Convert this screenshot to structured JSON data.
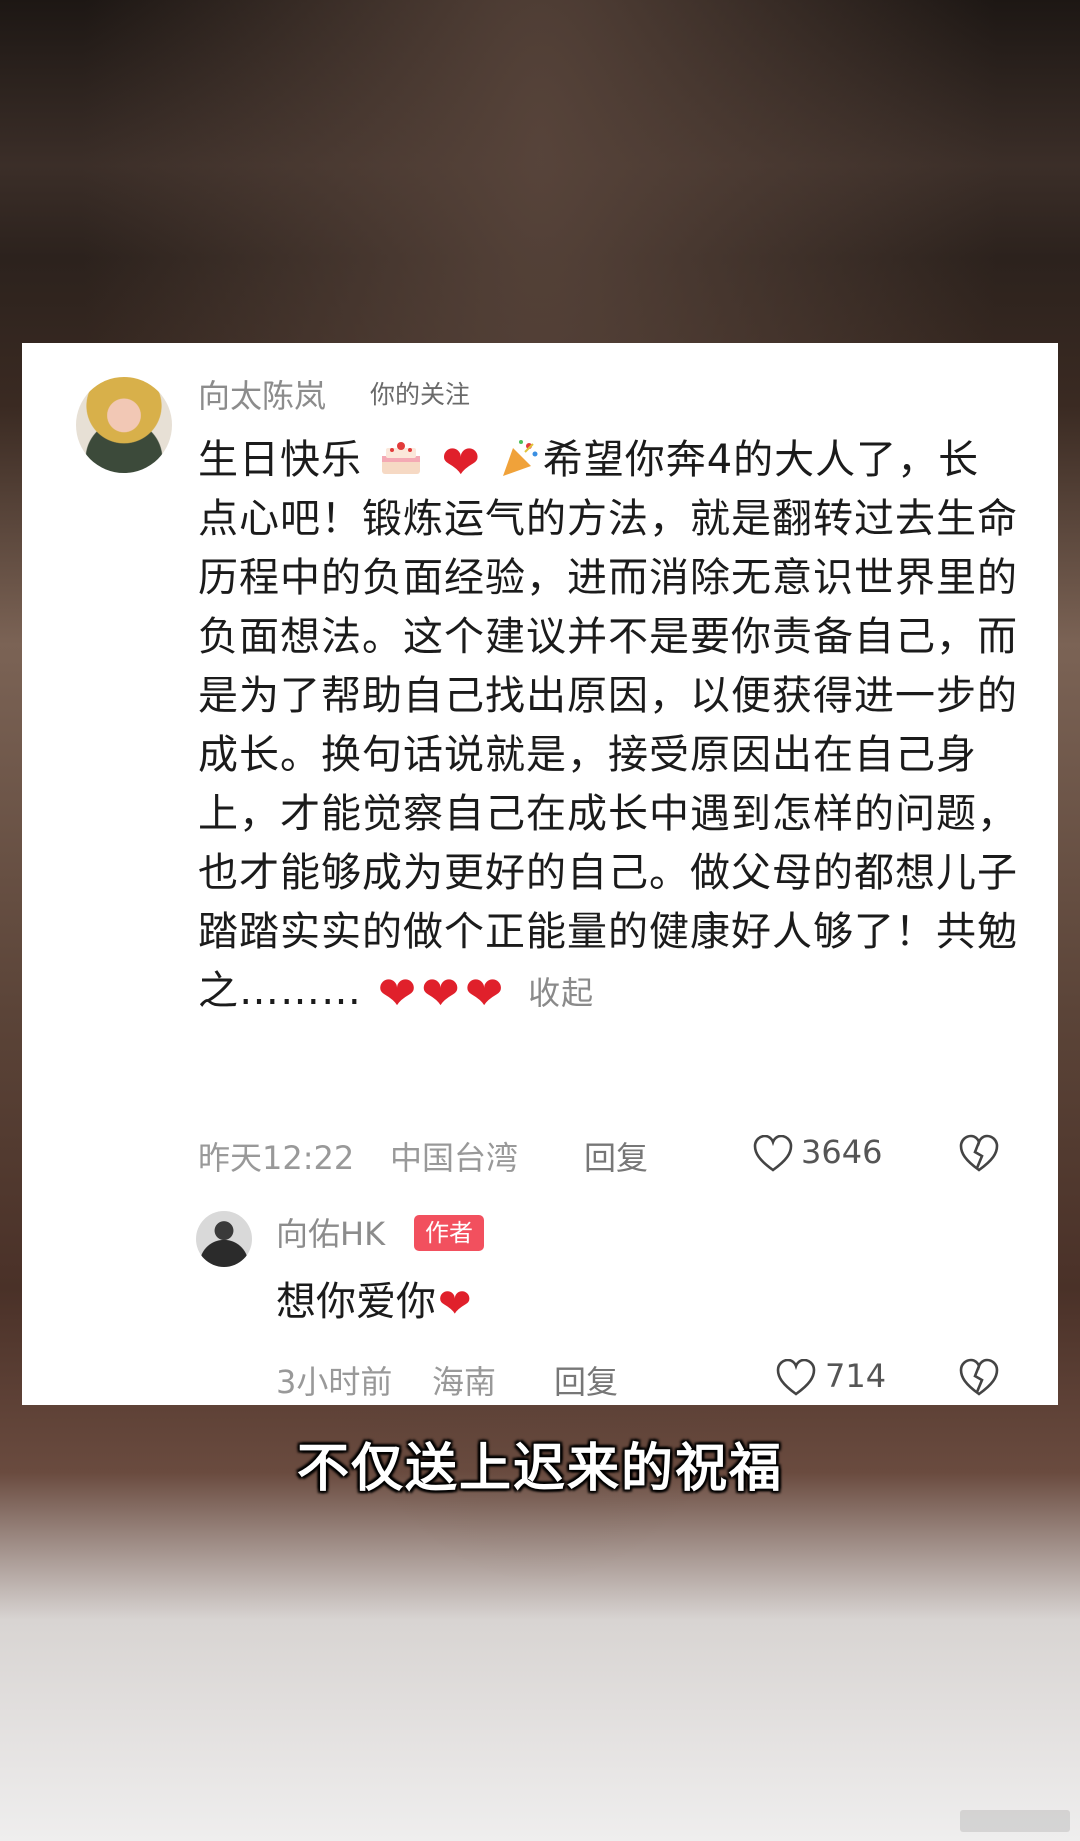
{
  "comment": {
    "author": "向太陈岚",
    "follow_label": "你的关注",
    "text_part1": "生日快乐",
    "text_part2": "希望你奔4的大人了，长点心吧！锻炼运气的方法，就是翻转过去生命历程中的负面经验，进而消除无意识世界里的负面想法。这个建议并不是要你责备自己，而是为了帮助自己找出原因，以便获得进一步的成长。换句话说就是，接受原因出在自己身上，才能觉察自己在成长中遇到怎样的问题，也才能够成为更好的自己。做父母的都想儿子踏踏实实的做个正能量的健康好人够了！共勉之………",
    "collapse_label": "收起",
    "time": "昨天12:22",
    "location": "中国台湾",
    "reply_label": "回复",
    "likes": "3646"
  },
  "reply": {
    "author": "向佑HK",
    "badge": "作者",
    "text": "想你爱你",
    "time": "3小时前",
    "location": "海南",
    "reply_label": "回复",
    "likes": "714"
  },
  "subtitle": "不仅送上迟来的祝福",
  "icons": {
    "like": "heart-outline-icon",
    "dislike": "broken-heart-icon",
    "heart_emoji": "red-heart-emoji",
    "cake_emoji": "cake-emoji",
    "party_emoji": "party-popper-emoji"
  },
  "colors": {
    "badge": "#f2505e",
    "heart": "#e0202b"
  }
}
